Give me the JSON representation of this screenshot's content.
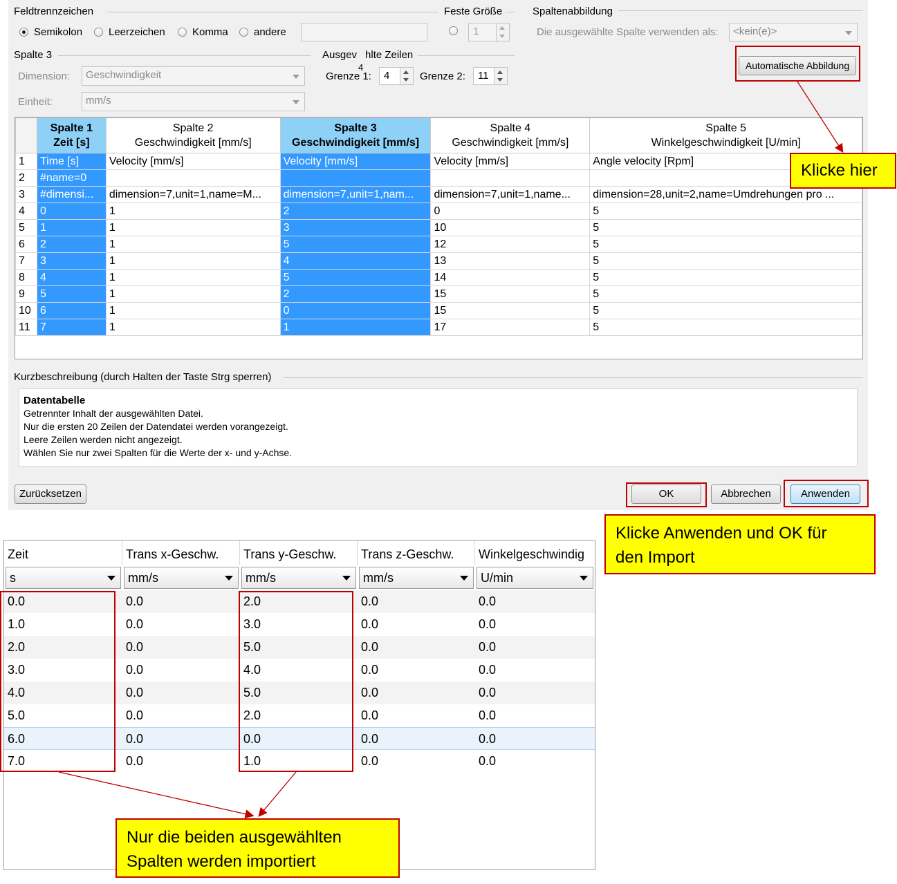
{
  "dialog": {
    "separator": {
      "title": "Feldtrennzeichen",
      "options": [
        "Semikolon",
        "Leerzeichen",
        "Komma",
        "andere"
      ],
      "selected": "Semikolon",
      "other_value": ""
    },
    "fixed_size": {
      "title": "Feste Größe",
      "value": "1"
    },
    "column_mapping": {
      "title": "Spaltenabbildung",
      "use_as_label": "Die ausgewählte Spalte verwenden als:",
      "use_as_value": "<kein(e)>",
      "auto_button": "Automatische Abbildung"
    },
    "column3": {
      "title": "Spalte 3",
      "dimension_label": "Dimension:",
      "dimension_value": "Geschwindigkeit",
      "unit_label": "Einheit:",
      "unit_value": "mm/s"
    },
    "selected_rows": {
      "title": "Ausgev",
      "title_rest": "hlte Zeilen",
      "overlay": "4",
      "limit1_label": "Grenze 1:",
      "limit1_value": "4",
      "limit2_label": "Grenze 2:",
      "limit2_value": "11"
    },
    "grid": {
      "columns": [
        {
          "line1": "Spalte 1",
          "line2": "Zeit [s]",
          "selected": true
        },
        {
          "line1": "Spalte 2",
          "line2": "Geschwindigkeit [mm/s]",
          "selected": false
        },
        {
          "line1": "Spalte 3",
          "line2": "Geschwindigkeit [mm/s]",
          "selected": true
        },
        {
          "line1": "Spalte 4",
          "line2": "Geschwindigkeit [mm/s]",
          "selected": false
        },
        {
          "line1": "Spalte 5",
          "line2": "Winkelgeschwindigkeit [U/min]",
          "selected": false
        }
      ],
      "rows": [
        [
          "1",
          "Time [s]",
          "Velocity [mm/s]",
          "Velocity [mm/s]",
          "Velocity [mm/s]",
          "Angle velocity [Rpm]"
        ],
        [
          "2",
          "#name=0",
          "",
          "",
          "",
          ""
        ],
        [
          "3",
          "#dimensi...",
          "dimension=7,unit=1,name=M...",
          "dimension=7,unit=1,nam...",
          "dimension=7,unit=1,name...",
          "dimension=28,unit=2,name=Umdrehungen pro ..."
        ],
        [
          "4",
          "0",
          "1",
          "2",
          "0",
          "5"
        ],
        [
          "5",
          "1",
          "1",
          "3",
          "10",
          "5"
        ],
        [
          "6",
          "2",
          "1",
          "5",
          "12",
          "5"
        ],
        [
          "7",
          "3",
          "1",
          "4",
          "13",
          "5"
        ],
        [
          "8",
          "4",
          "1",
          "5",
          "14",
          "5"
        ],
        [
          "9",
          "5",
          "1",
          "2",
          "15",
          "5"
        ],
        [
          "10",
          "6",
          "1",
          "0",
          "15",
          "5"
        ],
        [
          "11",
          "7",
          "1",
          "1",
          "17",
          "5"
        ]
      ]
    },
    "description": {
      "header": "Kurzbeschreibung (durch Halten der Taste Strg sperren)",
      "title": "Datentabelle",
      "lines": [
        "Getrennter Inhalt der ausgewählten Datei.",
        "Nur die ersten 20 Zeilen der Datendatei werden vorangezeigt.",
        "Leere Zeilen werden nicht angezeigt.",
        "Wählen Sie nur zwei Spalten für die Werte der x- und y-Achse."
      ]
    },
    "buttons": {
      "reset": "Zurücksetzen",
      "ok": "OK",
      "cancel": "Abbrechen",
      "apply": "Anwenden"
    }
  },
  "callouts": {
    "click_here": "Klicke hier",
    "apply_ok_line1": "Klicke Anwenden und OK für",
    "apply_ok_line2": "den Import",
    "only_two_line1": "Nur die beiden ausgewählten",
    "only_two_line2": "Spalten werden importiert"
  },
  "import_table": {
    "headers": [
      "Zeit",
      "Trans x-Geschw.",
      "Trans y-Geschw.",
      "Trans z-Geschw.",
      "Winkelgeschwindig"
    ],
    "units": [
      "s",
      "mm/s",
      "mm/s",
      "mm/s",
      "U/min"
    ],
    "rows": [
      [
        "0.0",
        "0.0",
        "2.0",
        "0.0",
        "0.0"
      ],
      [
        "1.0",
        "0.0",
        "3.0",
        "0.0",
        "0.0"
      ],
      [
        "2.0",
        "0.0",
        "5.0",
        "0.0",
        "0.0"
      ],
      [
        "3.0",
        "0.0",
        "4.0",
        "0.0",
        "0.0"
      ],
      [
        "4.0",
        "0.0",
        "5.0",
        "0.0",
        "0.0"
      ],
      [
        "5.0",
        "0.0",
        "2.0",
        "0.0",
        "0.0"
      ],
      [
        "6.0",
        "0.0",
        "0.0",
        "0.0",
        "0.0"
      ],
      [
        "7.0",
        "0.0",
        "1.0",
        "0.0",
        "0.0"
      ]
    ],
    "highlighted_row": 6
  }
}
